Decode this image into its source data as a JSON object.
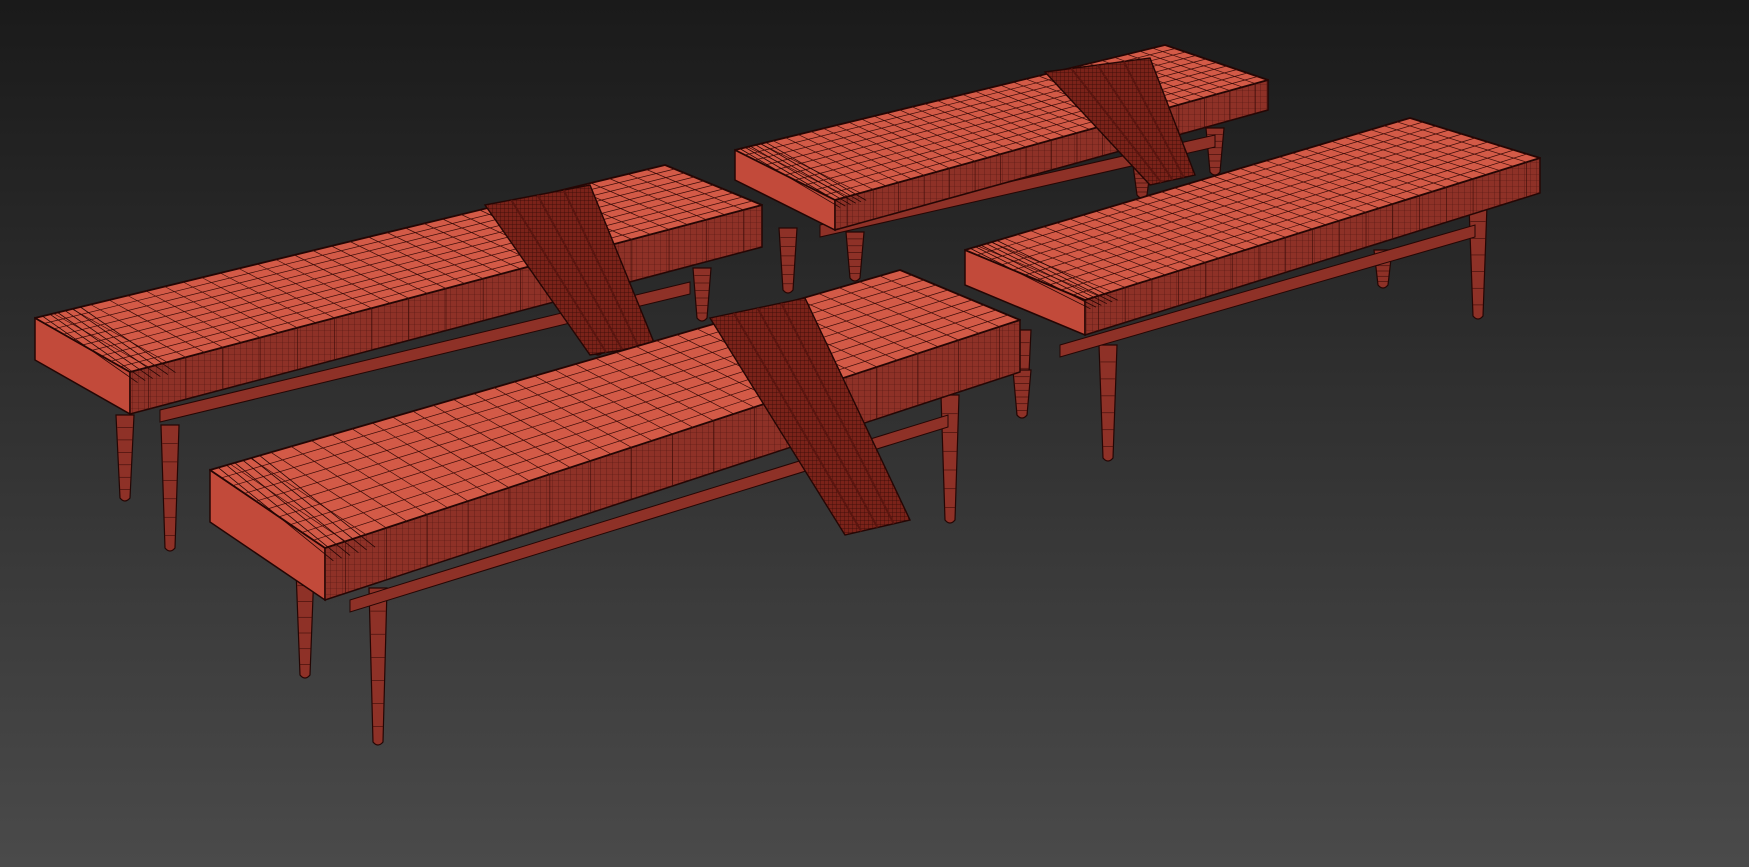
{
  "viewport": {
    "background_top": "#1a1a1a",
    "background_bottom": "#4a4a4a"
  },
  "colors": {
    "mesh_fill": "#c24a3a",
    "mesh_fill_dark": "#8e3127",
    "mesh_fill_light": "#d35a47",
    "wire": "#3b0c08",
    "wire_strong": "#240604",
    "throw": "#7a2219",
    "throw_dark": "#5a150f"
  },
  "objects": [
    {
      "name": "bench-back-left",
      "has_throw": true
    },
    {
      "name": "bench-back-right",
      "has_throw": true
    },
    {
      "name": "bench-front-left",
      "has_throw": true
    },
    {
      "name": "bench-front-right",
      "has_throw": false
    }
  ]
}
